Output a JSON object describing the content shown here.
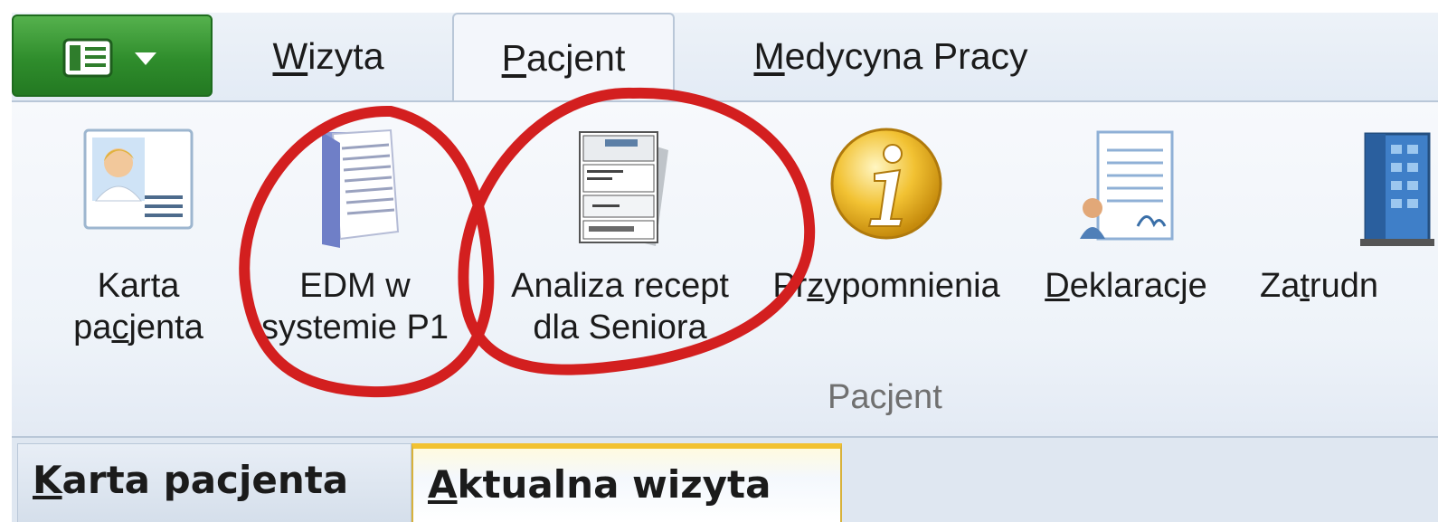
{
  "colors": {
    "app_button": "#2f8d2c",
    "annotation_red": "#d31f1f",
    "active_doc_tab_border": "#f2c232"
  },
  "app_menu": {
    "icon": "list-dropdown-icon"
  },
  "tabs": [
    {
      "label": "Wizyta",
      "mnemonic": "W",
      "rest": "izyta"
    },
    {
      "label": "Pacjent",
      "mnemonic": "P",
      "rest": "acjent",
      "active": true
    },
    {
      "label": "Medycyna Pracy",
      "mnemonic": "M",
      "rest": "edycyna Pracy"
    }
  ],
  "ribbon": {
    "group_label": "Pacjent",
    "buttons": [
      {
        "line1": "Karta",
        "line2_pre": "pa",
        "line2_mn": "c",
        "line2_post": "jenta",
        "icon": "patient-card-icon"
      },
      {
        "line1": "EDM w",
        "line2": "systemie P1",
        "icon": "document-folder-icon"
      },
      {
        "line1": "Analiza recept",
        "line2": "dla Seniora",
        "icon": "prescription-forms-icon"
      },
      {
        "pre": "Pr",
        "mn": "z",
        "post": "ypomnienia",
        "icon": "info-icon"
      },
      {
        "pre": "",
        "mn": "D",
        "post": "eklaracje",
        "icon": "declaration-icon"
      },
      {
        "pre": "Za",
        "mn": "t",
        "post": "rudn",
        "icon": "building-icon"
      }
    ]
  },
  "doc_tabs": [
    {
      "mn": "K",
      "rest": "arta pacjenta"
    },
    {
      "mn": "A",
      "rest": "ktualna wizyta",
      "active": true
    }
  ]
}
